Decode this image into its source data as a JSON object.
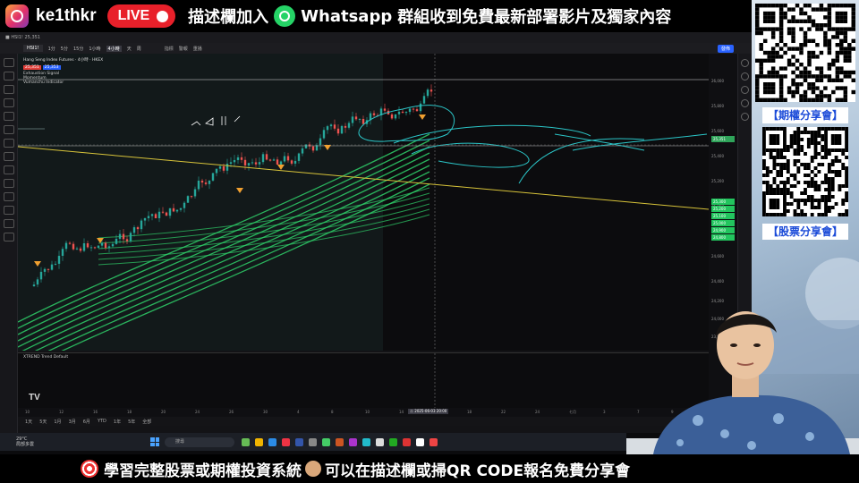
{
  "top_banner": {
    "channel": "ke1thkr",
    "live_label": "LIVE",
    "text_prefix": "描述欄加入",
    "text_whatsapp": "Whatsapp",
    "text_suffix": "群組收到免費最新部署影片及獨家內容"
  },
  "bottom_banner": {
    "text_a": "學習完整股票或期權投資系統",
    "text_b": "可以在描述欄或掃QR CODE報名免費分享會"
  },
  "right_panel": {
    "options_label": "【期權分享會】",
    "stocks_label": "【股票分享會】"
  },
  "toolbar": {
    "symbol": "HSI1!",
    "timeframes": [
      "1分",
      "5分",
      "15分",
      "1小時",
      "4小時",
      "天",
      "周"
    ],
    "active_timeframe": "4小時",
    "indicators_label": "指標",
    "alert_label": "警報",
    "replay_label": "重播",
    "publish_label": "發佈"
  },
  "legend": {
    "title": "Hang Seng Index Futures · 4小時 · HKEX",
    "line2": "Exhaustion Signal",
    "line3": "Momentum",
    "line4": "Vumanchu Indicator",
    "ind_label": "XTREND Trend Default"
  },
  "price_axis": {
    "labels": [
      "26,000",
      "25,800",
      "25,600",
      "25,400",
      "25,200",
      "25,000",
      "24,800",
      "24,600",
      "24,400",
      "24,200",
      "24,000",
      "23,800"
    ],
    "current_price": "25,351",
    "green_tags": [
      "25,300",
      "25,200",
      "25,100",
      "25,000",
      "24,900",
      "24,800"
    ]
  },
  "time_axis": {
    "labels": [
      "10",
      "12",
      "16",
      "18",
      "20",
      "24",
      "26",
      "30",
      "4",
      "8",
      "10",
      "14",
      "16",
      "18",
      "22",
      "24",
      "七月",
      "3",
      "7",
      "9"
    ],
    "crosshair": "二 2025-06-03 20:00"
  },
  "bottom_bar": {
    "ranges": [
      "1天",
      "5天",
      "1月",
      "3月",
      "6月",
      "YTD",
      "1年",
      "5年",
      "全部"
    ]
  },
  "taskbar": {
    "weather_line1": "29°C",
    "weather_line2": "局部多雲",
    "search_placeholder": "搜尋"
  },
  "colors": {
    "live_red": "#e8202a",
    "whatsapp_green": "#25d366",
    "band_green": "#2fd06a",
    "trend_cyan": "#2bc6c8",
    "trendline_yellow": "#d8c43a",
    "up_candle": "#26a69a",
    "down_candle": "#ef5350"
  }
}
